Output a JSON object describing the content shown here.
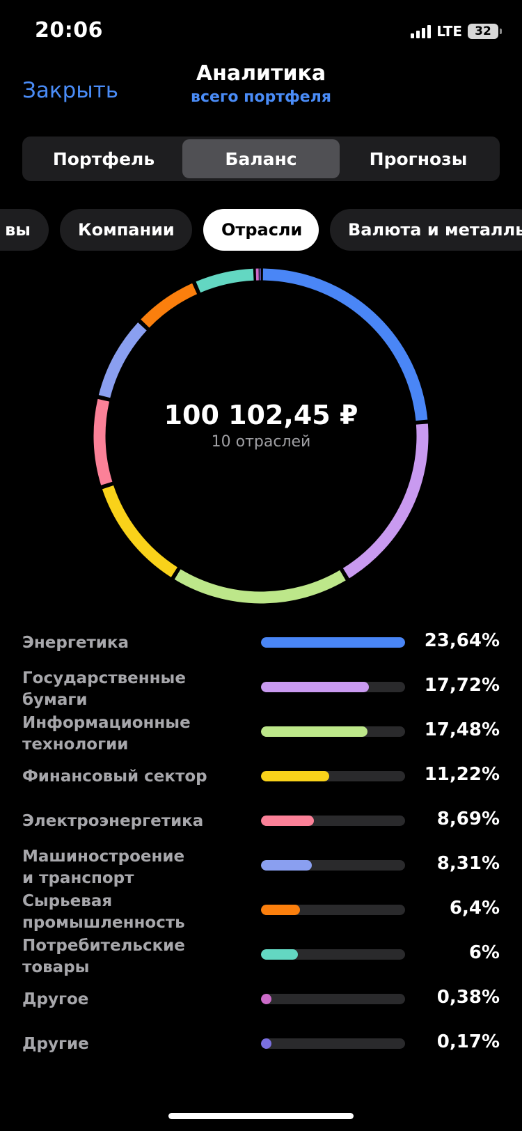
{
  "status_bar": {
    "time": "20:06",
    "network": "LTE",
    "battery": "32"
  },
  "header": {
    "close_label": "Закрыть",
    "title": "Аналитика",
    "subtitle": "всего портфеля"
  },
  "segmented": {
    "tabs": [
      "Портфель",
      "Баланс",
      "Прогнозы"
    ],
    "selected": "Баланс"
  },
  "chips": {
    "items": [
      "вы",
      "Компании",
      "Отрасли",
      "Валюта и металлы"
    ],
    "selected": "Отрасли"
  },
  "summary": {
    "total": "100 102,45 ₽",
    "count_label": "10 отраслей"
  },
  "chart_data": {
    "type": "pie",
    "categories": [
      "Энергетика",
      "Государственные бумаги",
      "Информационные технологии",
      "Финансовый сектор",
      "Электроэнергетика",
      "Машиностроение и транспорт",
      "Сырьевая промышленность",
      "Потребительские товары",
      "Другое",
      "Другие"
    ],
    "values": [
      23.64,
      17.72,
      17.48,
      11.22,
      8.69,
      8.31,
      6.4,
      6,
      0.38,
      0.17
    ],
    "colors": [
      "#4a86f6",
      "#c99af0",
      "#bde78a",
      "#f9d21a",
      "#fb8198",
      "#8a9ff0",
      "#fb7f0d",
      "#63d7c2",
      "#cc6bc9",
      "#7a6fe0"
    ]
  },
  "legend": {
    "rows": [
      {
        "label": "Энергетика",
        "pct": "23,64%"
      },
      {
        "label": "Государственные\nбумаги",
        "pct": "17,72%"
      },
      {
        "label": "Информационные\nтехнологии",
        "pct": "17,48%"
      },
      {
        "label": "Финансовый сектор",
        "pct": "11,22%"
      },
      {
        "label": "Электроэнергетика",
        "pct": "8,69%"
      },
      {
        "label": "Машиностроение\nи транспорт",
        "pct": "8,31%"
      },
      {
        "label": "Сырьевая\nпромышленность",
        "pct": "6,4%"
      },
      {
        "label": "Потребительские\nтовары",
        "pct": "6%"
      },
      {
        "label": "Другое",
        "pct": "0,38%"
      },
      {
        "label": "Другие",
        "pct": "0,17%"
      }
    ]
  }
}
